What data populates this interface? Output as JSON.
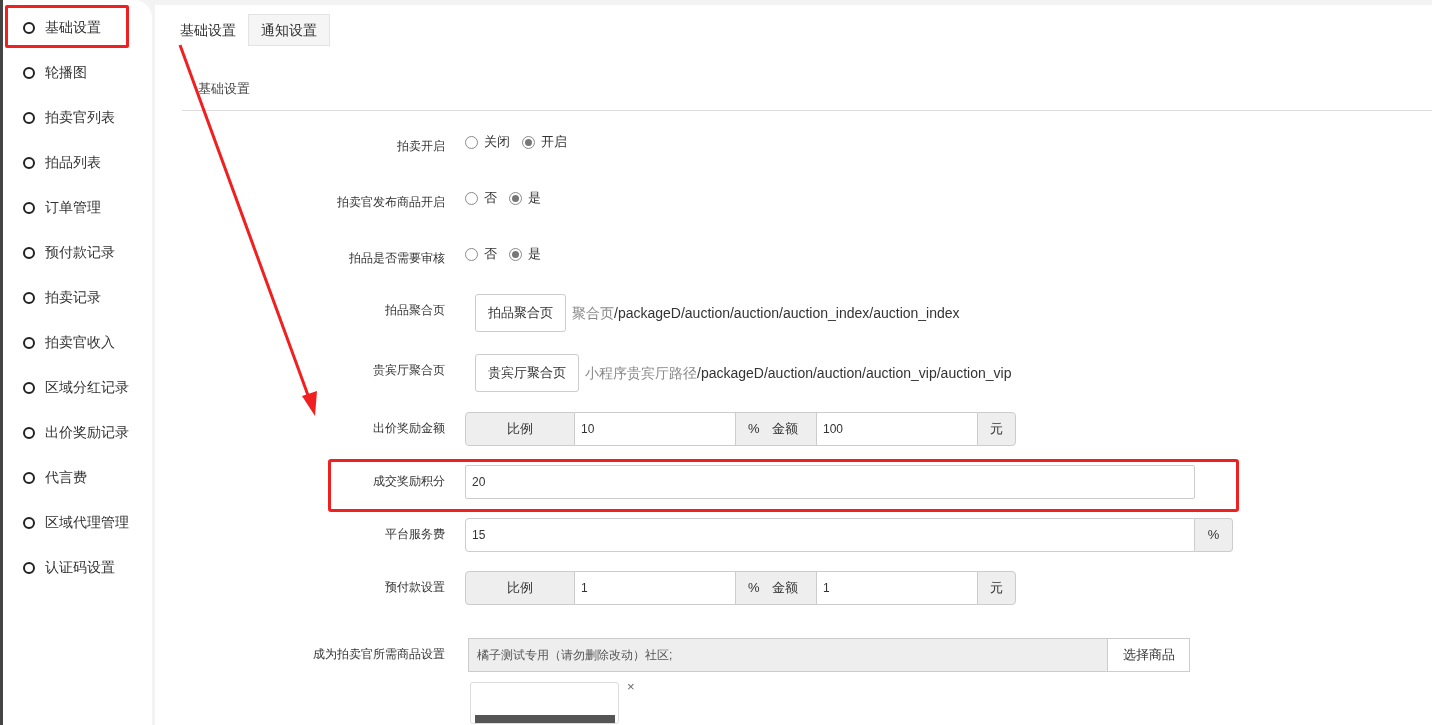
{
  "sidebar": {
    "items": [
      {
        "label": "基础设置",
        "highlighted": true
      },
      {
        "label": "轮播图",
        "highlighted": false
      },
      {
        "label": "拍卖官列表",
        "highlighted": false
      },
      {
        "label": "拍品列表",
        "highlighted": false
      },
      {
        "label": "订单管理",
        "highlighted": false
      },
      {
        "label": "预付款记录",
        "highlighted": false
      },
      {
        "label": "拍卖记录",
        "highlighted": false
      },
      {
        "label": "拍卖官收入",
        "highlighted": false
      },
      {
        "label": "区域分红记录",
        "highlighted": false
      },
      {
        "label": "出价奖励记录",
        "highlighted": false
      },
      {
        "label": "代言费",
        "highlighted": false
      },
      {
        "label": "区域代理管理",
        "highlighted": false
      },
      {
        "label": "认证码设置",
        "highlighted": false
      }
    ]
  },
  "tabs": [
    {
      "label": "基础设置",
      "selected": true
    },
    {
      "label": "通知设置",
      "selected": false
    }
  ],
  "section_title": "基础设置",
  "form": [
    {
      "kind": "radio",
      "label": "拍卖开启",
      "highlighted": false,
      "options": [
        {
          "label": "关闭",
          "selected": false
        },
        {
          "label": "开启",
          "selected": true
        }
      ]
    },
    {
      "kind": "radio",
      "label": "拍卖官发布商品开启",
      "highlighted": false,
      "options": [
        {
          "label": "否",
          "selected": false
        },
        {
          "label": "是",
          "selected": true
        }
      ]
    },
    {
      "kind": "radio",
      "label": "拍品是否需要审核",
      "highlighted": false,
      "options": [
        {
          "label": "否",
          "selected": false
        },
        {
          "label": "是",
          "selected": true
        }
      ]
    },
    {
      "kind": "link",
      "label": "拍品聚合页",
      "highlighted": false,
      "button": "拍品聚合页",
      "path_label": "聚合页",
      "path": "/packageD/auction/auction/auction_index/auction_index"
    },
    {
      "kind": "link",
      "label": "贵宾厅聚合页",
      "highlighted": false,
      "button": "贵宾厅聚合页",
      "path_label": "小程序贵宾厅路径",
      "path": "/packageD/auction/auction/auction_vip/auction_vip"
    },
    {
      "kind": "ratio",
      "label": "出价奖励金额",
      "highlighted": false,
      "prefix": "比例",
      "value1": "10",
      "unit1": "%",
      "prefix2": "金额",
      "value2": "100",
      "unit2": "元"
    },
    {
      "kind": "input",
      "label": "成交奖励积分",
      "highlighted": true,
      "value": "20"
    },
    {
      "kind": "input",
      "label": "平台服务费",
      "highlighted": false,
      "value": "15",
      "suffix": "%"
    },
    {
      "kind": "ratio",
      "label": "预付款设置",
      "highlighted": false,
      "prefix": "比例",
      "value1": "1",
      "unit1": "%",
      "prefix2": "金额",
      "value2": "1",
      "unit2": "元"
    },
    {
      "kind": "goods",
      "label": "成为拍卖官所需商品设置",
      "highlighted": false,
      "value": "橘子测试专用（请勿删除改动）社区;",
      "button": "选择商品",
      "remove": "×"
    }
  ]
}
